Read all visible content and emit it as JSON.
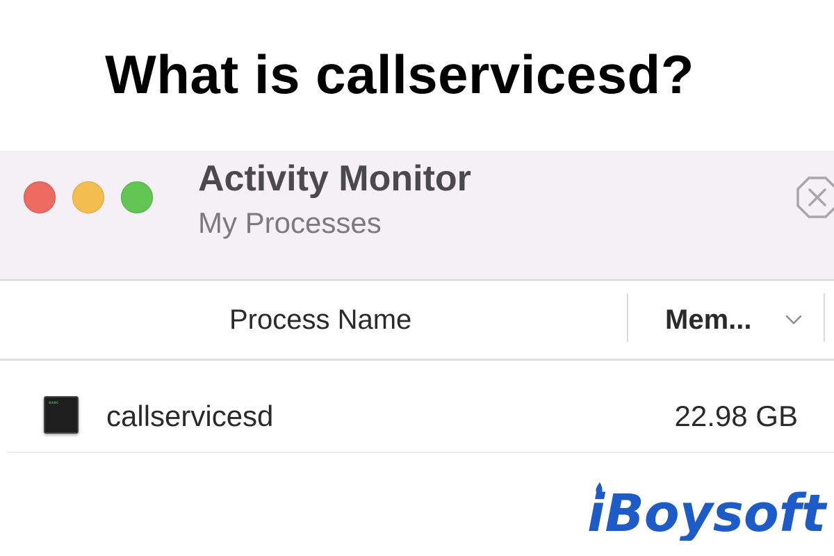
{
  "headline": "What is callservicesd?",
  "window": {
    "title": "Activity Monitor",
    "subtitle": "My Processes",
    "buttons": {
      "close_color": "#ec6a5f",
      "minimize_color": "#f4be4f",
      "maximize_color": "#62c655"
    },
    "stop_icon": "x-octagon-icon"
  },
  "table": {
    "columns": [
      {
        "label": "Process Name"
      },
      {
        "label": "Mem...",
        "sorted": true,
        "sort_icon": "chevron-down-icon"
      }
    ],
    "rows": [
      {
        "name": "callservicesd",
        "memory": "22.98 GB",
        "icon": "executable-icon"
      }
    ]
  },
  "watermark": {
    "text": "iBoysoft",
    "color": "#1d5bc9"
  }
}
